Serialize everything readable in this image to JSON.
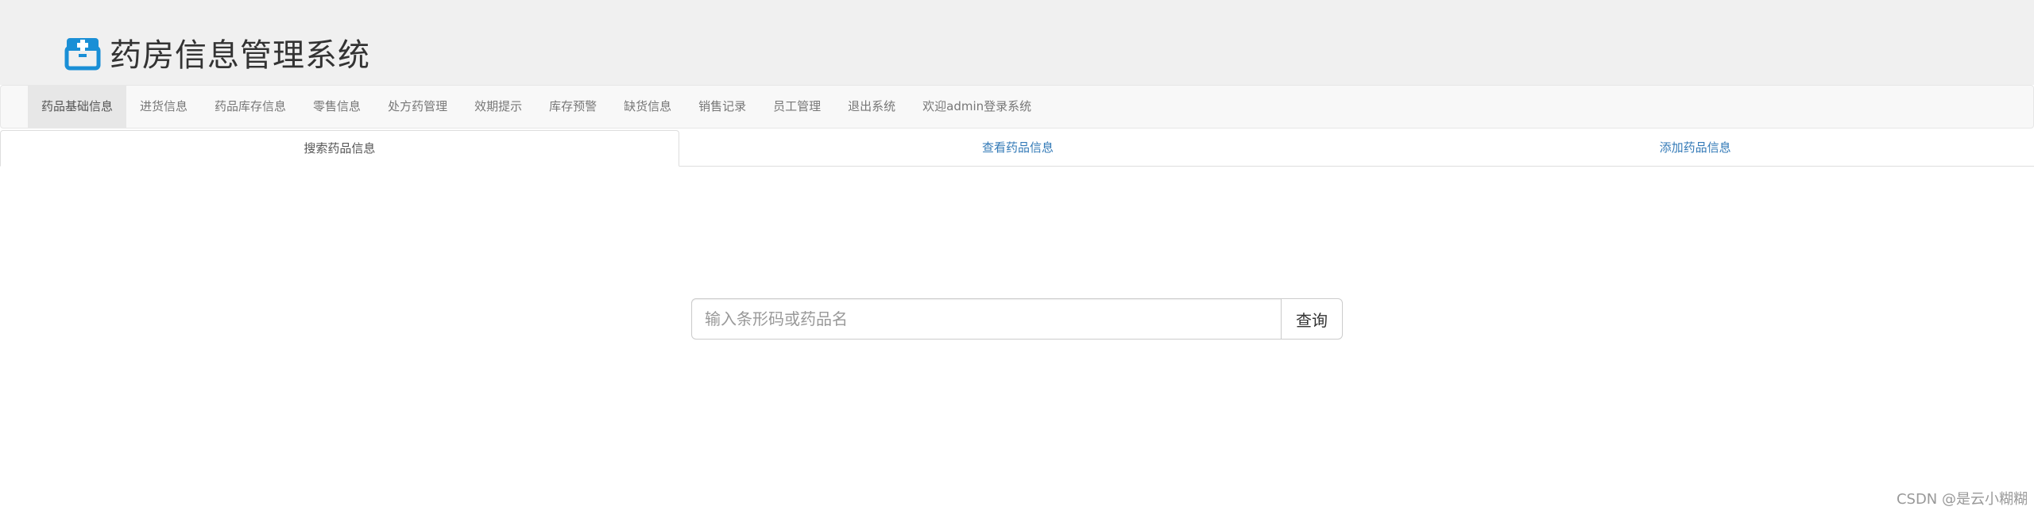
{
  "brand": {
    "title": "药房信息管理系统",
    "icon": "medicine-box-icon",
    "icon_color": "#1a8fd6"
  },
  "nav": {
    "items": [
      {
        "label": "药品基础信息",
        "active": true
      },
      {
        "label": "进货信息"
      },
      {
        "label": "药品库存信息"
      },
      {
        "label": "零售信息"
      },
      {
        "label": "处方药管理"
      },
      {
        "label": "效期提示"
      },
      {
        "label": "库存预警"
      },
      {
        "label": "缺货信息"
      },
      {
        "label": "销售记录"
      },
      {
        "label": "员工管理"
      },
      {
        "label": "退出系统"
      },
      {
        "label": "欢迎admin登录系统"
      }
    ]
  },
  "tabs": [
    {
      "label": "搜索药品信息",
      "active": true
    },
    {
      "label": "查看药品信息"
    },
    {
      "label": "添加药品信息"
    }
  ],
  "search": {
    "placeholder": "输入条形码或药品名",
    "value": "",
    "button_label": "查询"
  },
  "watermark": "CSDN @是云小糊糊",
  "colors": {
    "link": "#337ab7",
    "header_bg": "#f0f0f0",
    "navbar_bg": "#f8f8f8",
    "nav_active_bg": "#e7e7e7"
  }
}
